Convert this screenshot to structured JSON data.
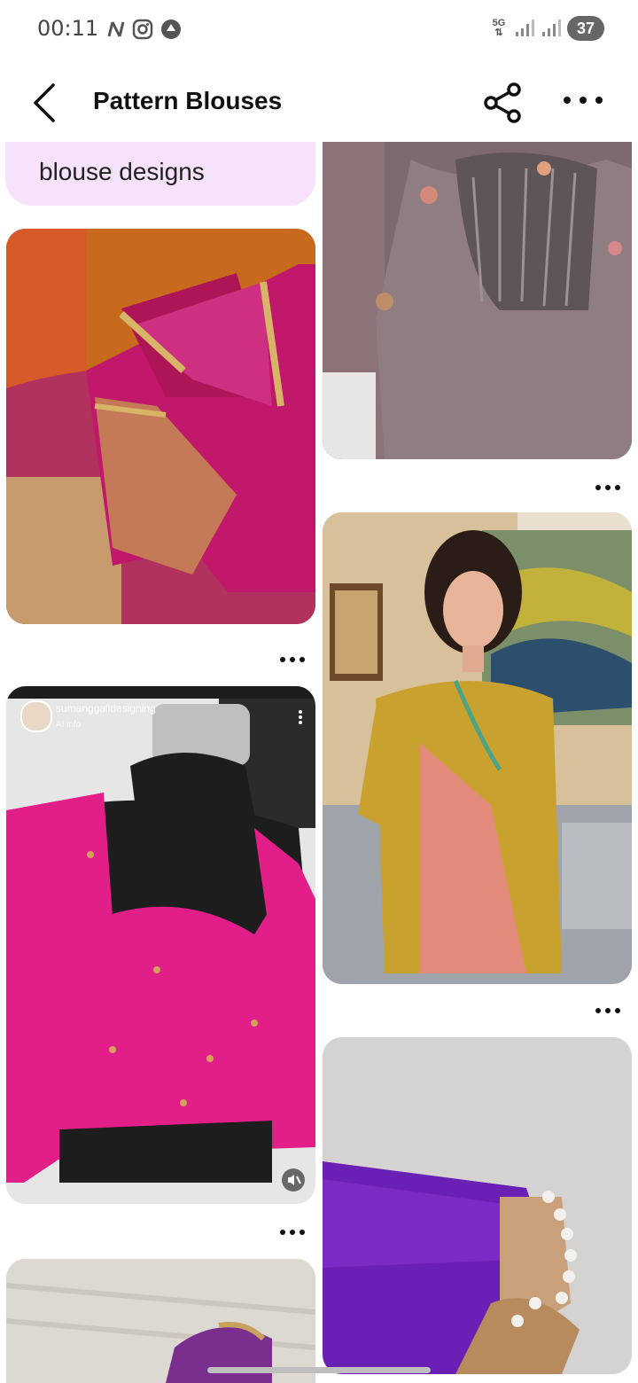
{
  "status_bar": {
    "time": "00:11",
    "network_label": "5G",
    "battery": "37"
  },
  "header": {
    "title": "Pattern Blouses"
  },
  "feed": {
    "top_pill_text": "blouse designs",
    "items": [
      {
        "name": "pin-orange-pink-blouse",
        "description_hidden": true
      },
      {
        "name": "pin-grey-floral-blouse",
        "description_hidden": true
      },
      {
        "name": "pin-yellow-saree",
        "description_hidden": true
      },
      {
        "name": "pin-pink-blouse-mannequin",
        "description_hidden": true
      },
      {
        "name": "pin-purple-blouse",
        "description_hidden": true
      }
    ],
    "video_pin": {
      "username": "sumanggalidesigning",
      "sub": "AI info"
    }
  },
  "colors": {
    "accent_pill": "#f7e2fb",
    "text_primary": "#111111",
    "background": "#ffffff"
  }
}
